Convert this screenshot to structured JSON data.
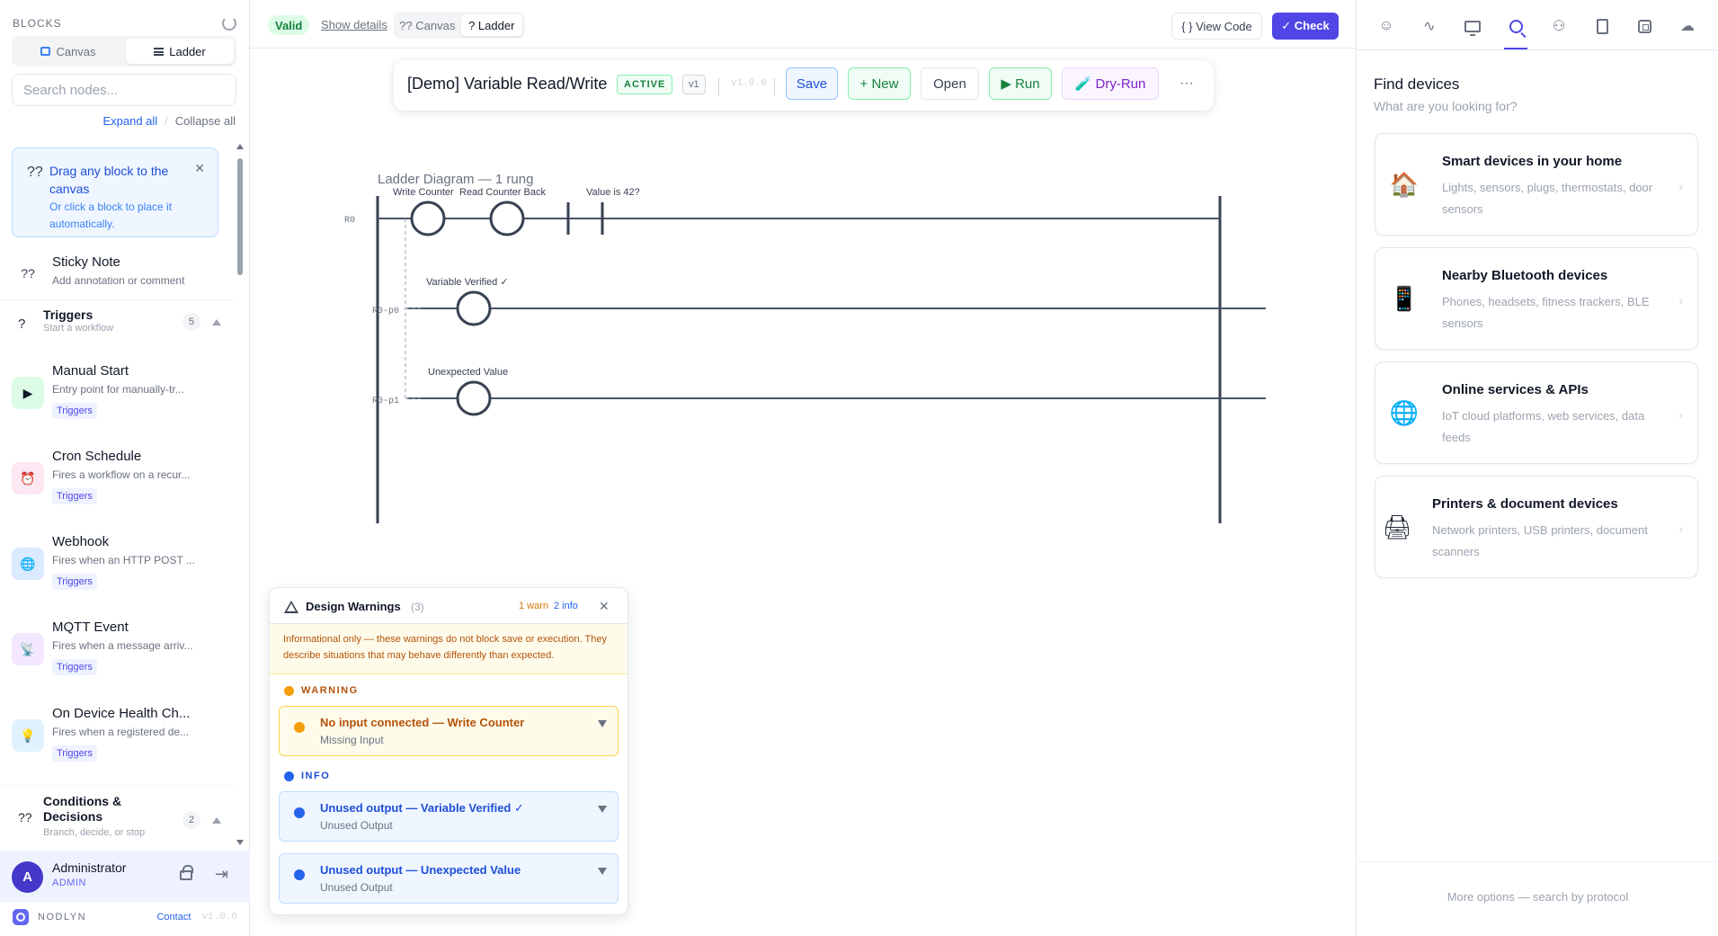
{
  "sidebar": {
    "title": "BLOCKS",
    "view_canvas": "Canvas",
    "view_ladder": "Ladder",
    "search_placeholder": "Search nodes...",
    "expand_all": "Expand all",
    "collapse_all": "Collapse all",
    "hint": {
      "icon": "??",
      "title": "Drag any block to the canvas",
      "subtitle": "Or click a block to place it automatically."
    },
    "sticky": {
      "icon": "??",
      "title": "Sticky Note",
      "desc": "Add annotation or comment"
    },
    "triggers": {
      "icon": "?",
      "title": "Triggers",
      "subtitle": "Start a workflow",
      "count": "5"
    },
    "trigger_items": [
      {
        "title": "Manual Start",
        "desc": "Entry point for manually-tr...",
        "tag": "Triggers",
        "icon": "▶"
      },
      {
        "title": "Cron Schedule",
        "desc": "Fires a workflow on a recur...",
        "tag": "Triggers",
        "icon": "⏰"
      },
      {
        "title": "Webhook",
        "desc": "Fires when an HTTP POST ...",
        "tag": "Triggers",
        "icon": "🌐"
      },
      {
        "title": "MQTT Event",
        "desc": "Fires when a message arriv...",
        "tag": "Triggers",
        "icon": "📡"
      },
      {
        "title": "On Device Health Ch...",
        "desc": "Fires when a registered de...",
        "tag": "Triggers",
        "icon": "💡"
      }
    ],
    "conditions": {
      "icon": "??",
      "title": "Conditions & Decisions",
      "subtitle": "Branch, decide, or stop",
      "count": "2"
    },
    "user": {
      "initial": "A",
      "name": "Administrator",
      "role": "ADMIN"
    },
    "brand": {
      "name": "NODLYN",
      "contact": "Contact",
      "version": "v1.0.0"
    }
  },
  "topbar": {
    "valid": "Valid",
    "show_details": "Show details",
    "mode_canvas": "?? Canvas",
    "mode_ladder": "? Ladder",
    "view_code": "{ } View Code",
    "check": "✓ Check"
  },
  "toolbar": {
    "title": "[Demo] Variable Read/Write",
    "status": "ACTIVE",
    "version_badge": "v1",
    "version": "v1.0.0",
    "save": "Save",
    "new": "+ New",
    "open": "Open",
    "run": "▶ Run",
    "dry_run": "🧪 Dry-Run",
    "more": "···"
  },
  "ladder": {
    "heading": "Ladder Diagram — 1 rung",
    "rung_labels": [
      "R0",
      "R0-p0",
      "R0-p1"
    ],
    "coil_labels": [
      "Write Counter",
      "Read Counter Back",
      "Value is 42?",
      "Variable Verified ✓",
      "Unexpected Value"
    ]
  },
  "warnings": {
    "title": "Design Warnings",
    "count": "(3)",
    "warn_count": "1 warn",
    "info_count": "2 info",
    "note": "Informational only — these warnings do not block save or execution. They describe situations that may behave differently than expected.",
    "warning_label": "WARNING",
    "info_label": "INFO",
    "items": [
      {
        "title": "No input connected — Write Counter",
        "sub": "Missing Input"
      },
      {
        "title": "Unused output — Variable Verified ✓",
        "sub": "Unused Output"
      },
      {
        "title": "Unused output — Unexpected Value",
        "sub": "Unused Output"
      }
    ]
  },
  "right_panel": {
    "title": "Find devices",
    "subtitle": "What are you looking for?",
    "cards": [
      {
        "icon": "🏠",
        "title": "Smart devices in your home",
        "desc": "Lights, sensors, plugs, thermostats, door sensors"
      },
      {
        "icon": "📱",
        "title": "Nearby Bluetooth devices",
        "desc": "Phones, headsets, fitness trackers, BLE sensors"
      },
      {
        "icon": "🌐",
        "title": "Online services & APIs",
        "desc": "IoT cloud platforms, web services, data feeds"
      },
      {
        "icon": "🖨",
        "title": "Printers & document devices",
        "desc": "Network printers, USB printers, document scanners"
      }
    ],
    "footer": "More options — search by protocol"
  },
  "colors": {
    "accent": "#4f46e5",
    "valid": "#15803d",
    "warning": "#d97706",
    "info": "#2563eb"
  }
}
